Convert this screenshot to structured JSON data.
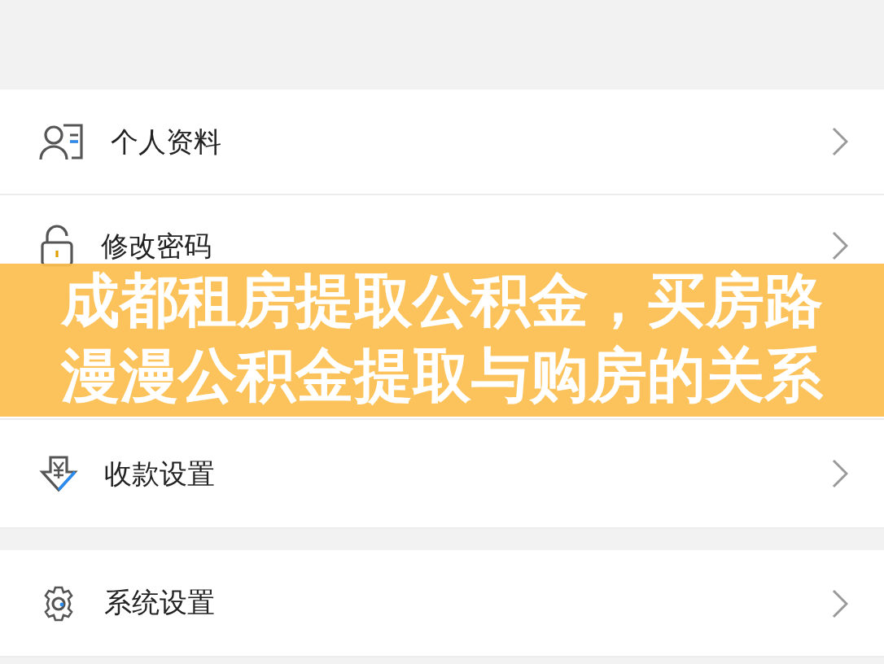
{
  "groups": [
    {
      "rows": [
        {
          "kind": "profile",
          "label": "个人资料"
        },
        {
          "kind": "lock",
          "label": "修改密码"
        },
        {
          "kind": "blank"
        },
        {
          "kind": "payment",
          "label": "收款设置"
        }
      ]
    },
    {
      "rows": [
        {
          "kind": "settings",
          "label": "系统设置"
        }
      ]
    }
  ],
  "banner": {
    "lines": [
      "成都租房提取公积金，买房路",
      "漫漫公积金提取与购房的关系"
    ]
  }
}
